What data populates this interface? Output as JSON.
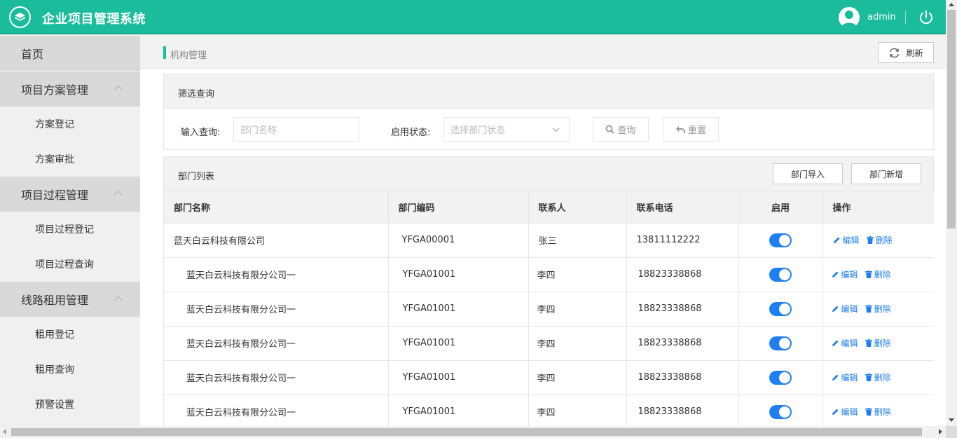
{
  "header": {
    "app_title": "企业项目管理系统",
    "username": "admin",
    "logo_icon": "layers-icon",
    "power_icon": "power-icon",
    "accent_color": "#1bbc9b"
  },
  "sidebar": {
    "home": "首页",
    "groups": [
      {
        "label": "项目方案管理",
        "items": [
          "方案登记",
          "方案审批"
        ]
      },
      {
        "label": "项目过程管理",
        "items": [
          "项目过程登记",
          "项目过程查询"
        ]
      },
      {
        "label": "线路租用管理",
        "items": [
          "租用登记",
          "租用查询",
          "预警设置"
        ]
      }
    ]
  },
  "breadcrumb": {
    "current": "机构管理",
    "refresh_label": "刷新"
  },
  "filter": {
    "title": "筛选查询",
    "query_label": "输入查询:",
    "query_placeholder": "部门名称",
    "status_label": "启用状态:",
    "status_placeholder": "选择部门状态",
    "search_label": "查询",
    "reset_label": "重置"
  },
  "list": {
    "title": "部门列表",
    "import_label": "部门导入",
    "add_label": "部门新增",
    "columns": [
      "部门名称",
      "部门编码",
      "联系人",
      "联系电话",
      "启用",
      "操作"
    ],
    "edit_label": "编辑",
    "delete_label": "删除",
    "switch_color": "#1e7ff2",
    "rows": [
      {
        "name": "蓝天白云科技有限公司",
        "code": "YFGA00001",
        "contact": "张三",
        "phone": "13811112222",
        "enabled": true
      },
      {
        "name": "蓝天白云科技有限分公司一",
        "code": "YFGA01001",
        "contact": "李四",
        "phone": "18823338868",
        "enabled": true
      },
      {
        "name": "蓝天白云科技有限分公司一",
        "code": "YFGA01001",
        "contact": "李四",
        "phone": "18823338868",
        "enabled": true
      },
      {
        "name": "蓝天白云科技有限分公司一",
        "code": "YFGA01001",
        "contact": "李四",
        "phone": "18823338868",
        "enabled": true
      },
      {
        "name": "蓝天白云科技有限分公司一",
        "code": "YFGA01001",
        "contact": "李四",
        "phone": "18823338868",
        "enabled": true
      },
      {
        "name": "蓝天白云科技有限分公司一",
        "code": "YFGA01001",
        "contact": "李四",
        "phone": "18823338868",
        "enabled": true
      }
    ]
  }
}
